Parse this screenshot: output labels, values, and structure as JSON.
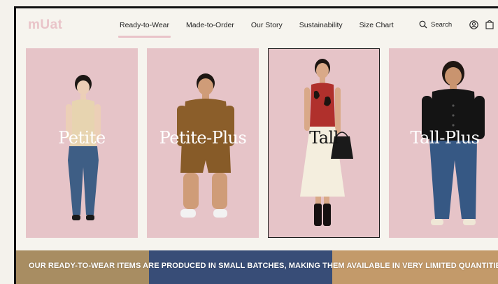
{
  "brand": {
    "logo_text": "mUat",
    "accent": "#e9c4c9"
  },
  "nav": {
    "items": [
      {
        "label": "Ready-to-Wear",
        "active": true
      },
      {
        "label": "Made-to-Order",
        "active": false
      },
      {
        "label": "Our Story",
        "active": false
      },
      {
        "label": "Sustainability",
        "active": false
      },
      {
        "label": "Size Chart",
        "active": false
      }
    ]
  },
  "header_actions": {
    "search_label": "Search",
    "icons": [
      "search-icon",
      "account-icon",
      "shopping-bag-icon"
    ]
  },
  "categories": [
    {
      "label": "Petite",
      "selected": false
    },
    {
      "label": "Petite-Plus",
      "selected": false
    },
    {
      "label": "Tall",
      "selected": true
    },
    {
      "label": "Tall-Plus",
      "selected": false
    }
  ],
  "banner": {
    "text": "OUR READY-TO-WEAR ITEMS ARE PRODUCED IN SMALL BATCHES, MAKING THEM AVAILABLE IN VERY LIMITED QUANTITIES"
  },
  "colors": {
    "card_bg": "#e6c4c8",
    "page_bg": "#f6f4ee"
  }
}
